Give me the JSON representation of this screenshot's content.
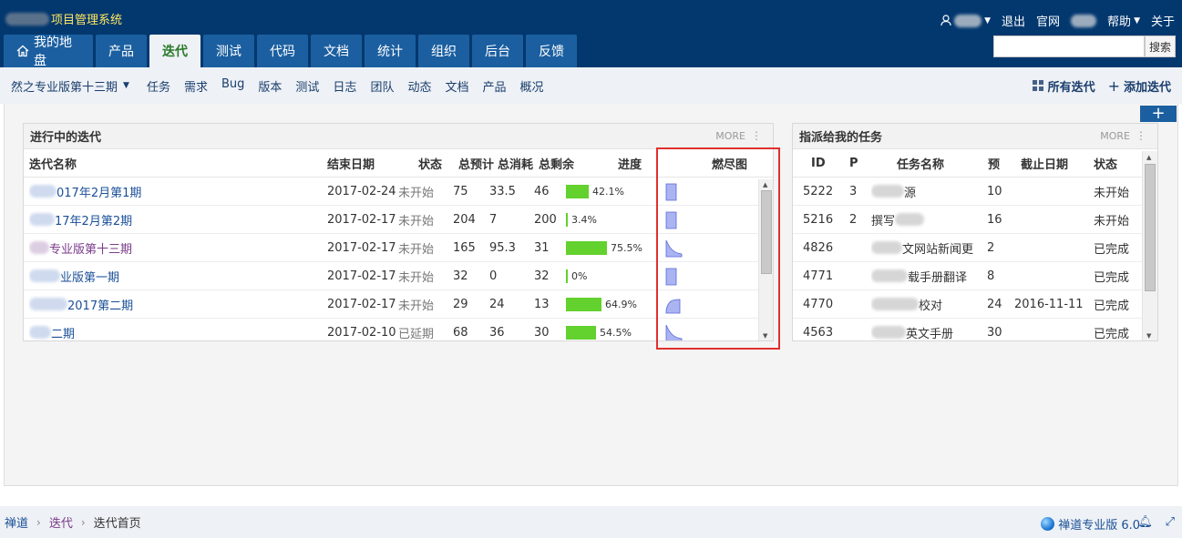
{
  "app": {
    "title_suffix": "项目管理系统"
  },
  "topbar": {
    "user_label": "",
    "logout": "退出",
    "official_site": "官网",
    "help": "帮助",
    "about": "关于",
    "search_button": "搜索",
    "search_value": ""
  },
  "main_nav": [
    {
      "label": "我的地盘",
      "icon": "home-icon",
      "active": false
    },
    {
      "label": "产品",
      "active": false
    },
    {
      "label": "迭代",
      "active": true
    },
    {
      "label": "测试",
      "active": false
    },
    {
      "label": "代码",
      "active": false
    },
    {
      "label": "文档",
      "active": false
    },
    {
      "label": "统计",
      "active": false
    },
    {
      "label": "组织",
      "active": false
    },
    {
      "label": "后台",
      "active": false
    },
    {
      "label": "反馈",
      "active": false
    }
  ],
  "sub_nav": {
    "project": "然之专业版第十三期",
    "items": [
      "任务",
      "需求",
      "Bug",
      "版本",
      "测试",
      "日志",
      "团队",
      "动态",
      "文档",
      "产品",
      "概况"
    ],
    "all_iterations": "所有迭代",
    "add_iteration": "添加迭代"
  },
  "add_block_icon": "+",
  "iterations_panel": {
    "title": "进行中的迭代",
    "more": "MORE",
    "columns": [
      "迭代名称",
      "结束日期",
      "状态",
      "总预计",
      "总消耗",
      "总剩余",
      "进度",
      "燃尽图"
    ],
    "rows": [
      {
        "name": "017年2月第1期",
        "end": "2017-02-24",
        "status": "未开始",
        "estimate": "75",
        "consumed": "33.5",
        "left": "46",
        "progress": 42.1,
        "progress_label": "42.1%",
        "burn": "flat",
        "visited": false
      },
      {
        "name": "17年2月第2期",
        "end": "2017-02-17",
        "status": "未开始",
        "estimate": "204",
        "consumed": "7",
        "left": "200",
        "progress": 3.4,
        "progress_label": "3.4%",
        "burn": "flat",
        "visited": false
      },
      {
        "name": "专业版第十三期",
        "end": "2017-02-17",
        "status": "未开始",
        "estimate": "165",
        "consumed": "95.3",
        "left": "31",
        "progress": 75.5,
        "progress_label": "75.5%",
        "burn": "down",
        "visited": true
      },
      {
        "name": "业版第一期",
        "end": "2017-02-17",
        "status": "未开始",
        "estimate": "32",
        "consumed": "0",
        "left": "32",
        "progress": 0,
        "progress_label": "0%",
        "burn": "flat",
        "visited": false
      },
      {
        "name": "2017第二期",
        "end": "2017-02-17",
        "status": "未开始",
        "estimate": "29",
        "consumed": "24",
        "left": "13",
        "progress": 64.9,
        "progress_label": "64.9%",
        "burn": "up",
        "visited": false
      },
      {
        "name": "二期",
        "end": "2017-02-10",
        "status": "已延期",
        "estimate": "68",
        "consumed": "36",
        "left": "30",
        "progress": 54.5,
        "progress_label": "54.5%",
        "burn": "down",
        "visited": false
      }
    ]
  },
  "tasks_panel": {
    "title": "指派给我的任务",
    "more": "MORE",
    "columns": [
      "ID",
      "P",
      "任务名称",
      "预",
      "截止日期",
      "状态"
    ],
    "rows": [
      {
        "id": "5222",
        "p": "3",
        "name": "源",
        "est": "10",
        "deadline": "",
        "status": "未开始"
      },
      {
        "id": "5216",
        "p": "2",
        "name": "撰写",
        "est": "16",
        "deadline": "",
        "status": "未开始"
      },
      {
        "id": "4826",
        "p": "",
        "name": "文网站新闻更",
        "est": "2",
        "deadline": "",
        "status": "已完成"
      },
      {
        "id": "4771",
        "p": "",
        "name": "载手册翻译",
        "est": "8",
        "deadline": "",
        "status": "已完成"
      },
      {
        "id": "4770",
        "p": "",
        "name": "校对",
        "est": "24",
        "deadline": "2016-11-11",
        "status": "已完成"
      },
      {
        "id": "4563",
        "p": "",
        "name": "英文手册",
        "est": "30",
        "deadline": "",
        "status": "已完成"
      }
    ]
  },
  "footer": {
    "breadcrumb": [
      "禅道",
      "迭代",
      "迭代首页"
    ],
    "version": "禅道专业版 6.0"
  },
  "colors": {
    "topbar": "#03386f",
    "tab": "#1b5fa0",
    "progress": "#63d12e",
    "highlight": "#e0302e",
    "burndown": "#aab4f2"
  }
}
